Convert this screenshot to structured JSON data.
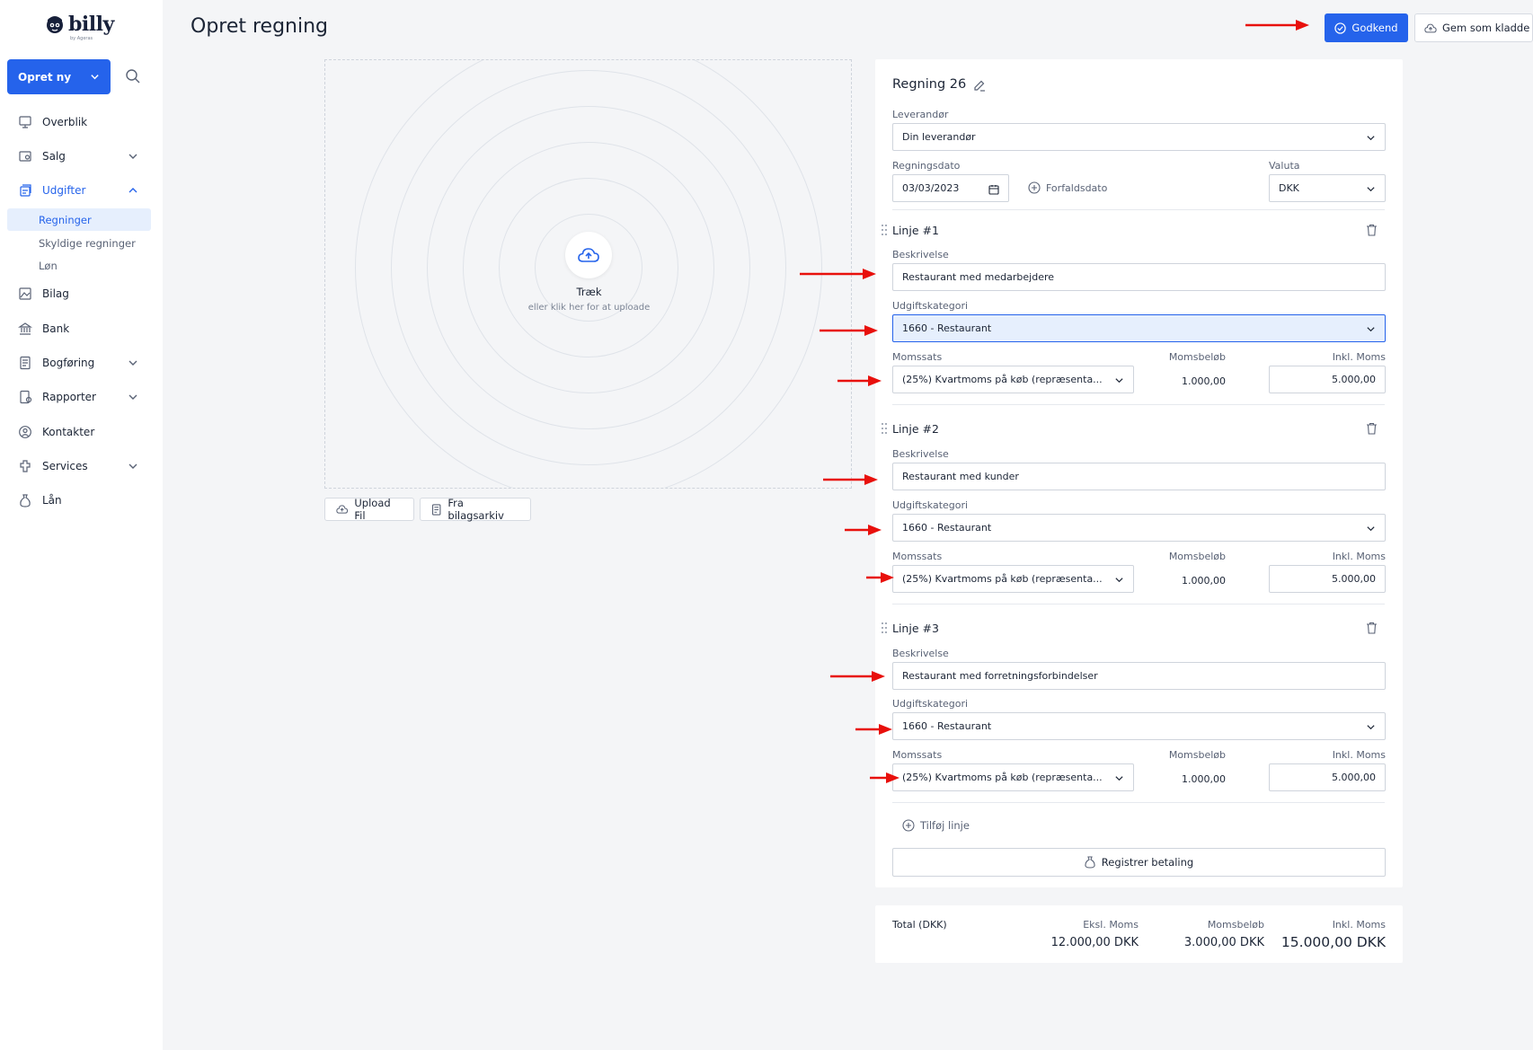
{
  "brand": {
    "name": "billy",
    "sub": "by Ageras"
  },
  "sidebar": {
    "create_label": "Opret ny",
    "items": [
      {
        "label": "Overblik",
        "icon": "overview-icon"
      },
      {
        "label": "Salg",
        "icon": "sales-icon"
      },
      {
        "label": "Udgifter",
        "icon": "expenses-icon"
      },
      {
        "label": "Bilag",
        "icon": "attachments-icon"
      },
      {
        "label": "Bank",
        "icon": "bank-icon"
      },
      {
        "label": "Bogføring",
        "icon": "bookkeeping-icon"
      },
      {
        "label": "Rapporter",
        "icon": "reports-icon"
      },
      {
        "label": "Kontakter",
        "icon": "contacts-icon"
      },
      {
        "label": "Services",
        "icon": "services-icon"
      },
      {
        "label": "Lån",
        "icon": "loan-icon"
      }
    ],
    "sub_items": [
      "Regninger",
      "Skyldige regninger",
      "Løn"
    ]
  },
  "header": {
    "title": "Opret regning",
    "approve_label": "Godkend",
    "draft_label": "Gem som kladde"
  },
  "upload": {
    "drag_title": "Træk",
    "drag_sub": "eller klik her for at uploade",
    "upload_file_label": "Upload Fil",
    "archive_label": "Fra bilagsarkiv"
  },
  "form": {
    "title": "Regning 26",
    "supplier_label": "Leverandør",
    "supplier_value": "Din leverandør",
    "date_label": "Regningsdato",
    "date_value": "03/03/2023",
    "due_label": "Forfaldsdato",
    "currency_label": "Valuta",
    "currency_value": "DKK",
    "description_label": "Beskrivelse",
    "category_label": "Udgiftskategori",
    "vat_rate_label": "Momssats",
    "vat_amount_label": "Momsbeløb",
    "incl_vat_label": "Inkl. Moms",
    "lines": [
      {
        "title": "Linje #1",
        "description": "Restaurant med medarbejdere",
        "category": "1660 -  Restaurant",
        "vat_rate": "(25%) Kvartmoms på køb (repræsenta...",
        "vat_amount": "1.000,00",
        "incl_vat": "5.000,00"
      },
      {
        "title": "Linje #2",
        "description": "Restaurant med kunder",
        "category": "1660 -  Restaurant",
        "vat_rate": "(25%) Kvartmoms på køb (repræsenta...",
        "vat_amount": "1.000,00",
        "incl_vat": "5.000,00"
      },
      {
        "title": "Linje #3",
        "description": "Restaurant med forretningsforbindelser",
        "category": "1660 -  Restaurant",
        "vat_rate": "(25%) Kvartmoms på køb (repræsenta...",
        "vat_amount": "1.000,00",
        "incl_vat": "5.000,00"
      }
    ],
    "add_line_label": "Tilføj linje",
    "register_payment_label": "Registrer betaling"
  },
  "totals": {
    "label": "Total (DKK)",
    "excl_label": "Eksl. Moms",
    "excl_value": "12.000,00 DKK",
    "vat_label": "Momsbeløb",
    "vat_value": "3.000,00 DKK",
    "incl_label": "Inkl. Moms",
    "incl_value": "15.000,00 DKK"
  },
  "colors": {
    "accent": "#2563eb",
    "annotation": "#e8100c"
  }
}
